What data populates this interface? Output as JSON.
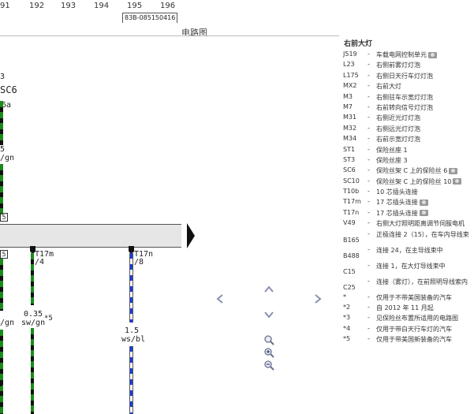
{
  "diagram": {
    "column_numbers": [
      "91",
      "192",
      "193",
      "194",
      "195",
      "196"
    ],
    "part_number_fragment": "83B-085150416",
    "title": "电路图",
    "labels": {
      "num3": "3",
      "sc6": "SC6",
      "sc6a": "6a",
      "wire_left_size": "5",
      "wire_left_color": "/gn",
      "conn_t17m": "T17m",
      "conn_t17m_pin": "/4",
      "conn_t17n": "T17n",
      "conn_t17n_pin": "/8",
      "wire_mid_size": "0.35",
      "wire_mid_color": "sw/gn",
      "wire_mid_note": "*5",
      "wire_right_size": "1.5",
      "wire_right_color": "ws/bl",
      "left_lower_color": "/gn",
      "box1": "5",
      "box2": "5"
    },
    "colors": {
      "green": "#1a8a1a",
      "blue": "#1a3fd6",
      "black": "#111111"
    }
  },
  "legend": {
    "title": "右前大灯",
    "items": [
      {
        "code": "J519",
        "desc": "车载电网控制单元",
        "camera": true
      },
      {
        "code": "L23",
        "desc": "右侧前雾灯灯泡",
        "camera": false
      },
      {
        "code": "L175",
        "desc": "右侧日天行车灯灯泡",
        "camera": false
      },
      {
        "code": "MX2",
        "desc": "右前大灯",
        "camera": false
      },
      {
        "code": "M3",
        "desc": "右侧驻车示宽灯灯泡",
        "camera": false
      },
      {
        "code": "M7",
        "desc": "右前转向信号灯灯泡",
        "camera": false
      },
      {
        "code": "M31",
        "desc": "右侧近光灯灯泡",
        "camera": false
      },
      {
        "code": "M32",
        "desc": "右侧远光灯灯泡",
        "camera": false
      },
      {
        "code": "M34",
        "desc": "右前示宽灯灯泡",
        "camera": false
      },
      {
        "code": "ST1",
        "desc": "保险丝座 1",
        "camera": false
      },
      {
        "code": "ST3",
        "desc": "保险丝座 3",
        "camera": false
      },
      {
        "code": "SC6",
        "desc": "保险丝架 C 上的保险丝 6",
        "camera": true
      },
      {
        "code": "SC10",
        "desc": "保险丝架 C 上的保险丝 10",
        "camera": true
      },
      {
        "code": "T10b",
        "desc": "10 芯插头连接",
        "camera": false
      },
      {
        "code": "T17m",
        "desc": "17 芯插头连接",
        "camera": true
      },
      {
        "code": "T17n",
        "desc": "17 芯插头连接",
        "camera": true
      },
      {
        "code": "V49",
        "desc": "右侧大灯照明距离调节伺服电机",
        "camera": false
      },
      {
        "code": "B165",
        "desc": "正极连接 2（15），在车内导线束",
        "camera": false
      },
      {
        "code": "B488",
        "desc": "连接 24，在主导线束中",
        "camera": false
      },
      {
        "code": "C15",
        "desc": "连接 1，在大灯导线束中",
        "camera": false
      },
      {
        "code": "C25",
        "desc": "连接（雾灯），在前照明导线索内",
        "camera": false
      },
      {
        "code": "*",
        "desc": "仅用于不带美国装备的汽车",
        "camera": false
      },
      {
        "code": "*2",
        "desc": "自 2012 年 11 月起",
        "camera": false
      },
      {
        "code": "*3",
        "desc": "见保险丝布置所适用的电路图",
        "camera": false
      },
      {
        "code": "*4",
        "desc": "仅用于带白天行车灯的汽车",
        "camera": false
      },
      {
        "code": "*5",
        "desc": "仅用于带美国新装备的汽车",
        "camera": false
      }
    ]
  },
  "navigation": {
    "left_icon": "chevron-left-icon",
    "right_icon": "chevron-right-icon",
    "up_icon": "chevron-up-icon",
    "down_icon": "chevron-down-icon",
    "zoom_icons": [
      "zoom-search-icon",
      "zoom-in-icon",
      "zoom-out-icon"
    ]
  }
}
